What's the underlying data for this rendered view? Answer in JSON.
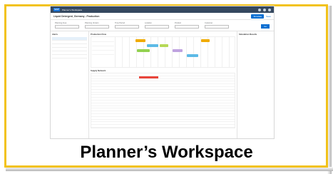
{
  "shell": {
    "title": "Planner's Workspace"
  },
  "page": {
    "title": "Liquid Detergent_Germany - Production",
    "primary_action": "Simulate",
    "secondary_action": "Save"
  },
  "filters": [
    {
      "label": "Planning Area",
      "value": ""
    },
    {
      "label": "Planning Version",
      "value": ""
    },
    {
      "label": "Time Period",
      "value": ""
    },
    {
      "label": "Location",
      "value": ""
    },
    {
      "label": "Product",
      "value": ""
    },
    {
      "label": "Customer",
      "value": ""
    }
  ],
  "filters_go": "Go",
  "alerts": {
    "header": "Alerts",
    "items": [
      {
        "title": "",
        "subtitle": ""
      },
      {
        "title": "",
        "subtitle": ""
      },
      {
        "title": "",
        "subtitle": ""
      },
      {
        "title": "",
        "subtitle": ""
      },
      {
        "title": "",
        "subtitle": ""
      },
      {
        "title": "",
        "subtitle": ""
      }
    ]
  },
  "production_flow": {
    "header": "Production Flow",
    "resources": [
      "",
      "",
      "",
      ""
    ]
  },
  "supply_network": {
    "header": "Supply Network"
  },
  "simulation": {
    "header": "Simulation Results"
  },
  "caption": "Planner’s Workspace"
}
